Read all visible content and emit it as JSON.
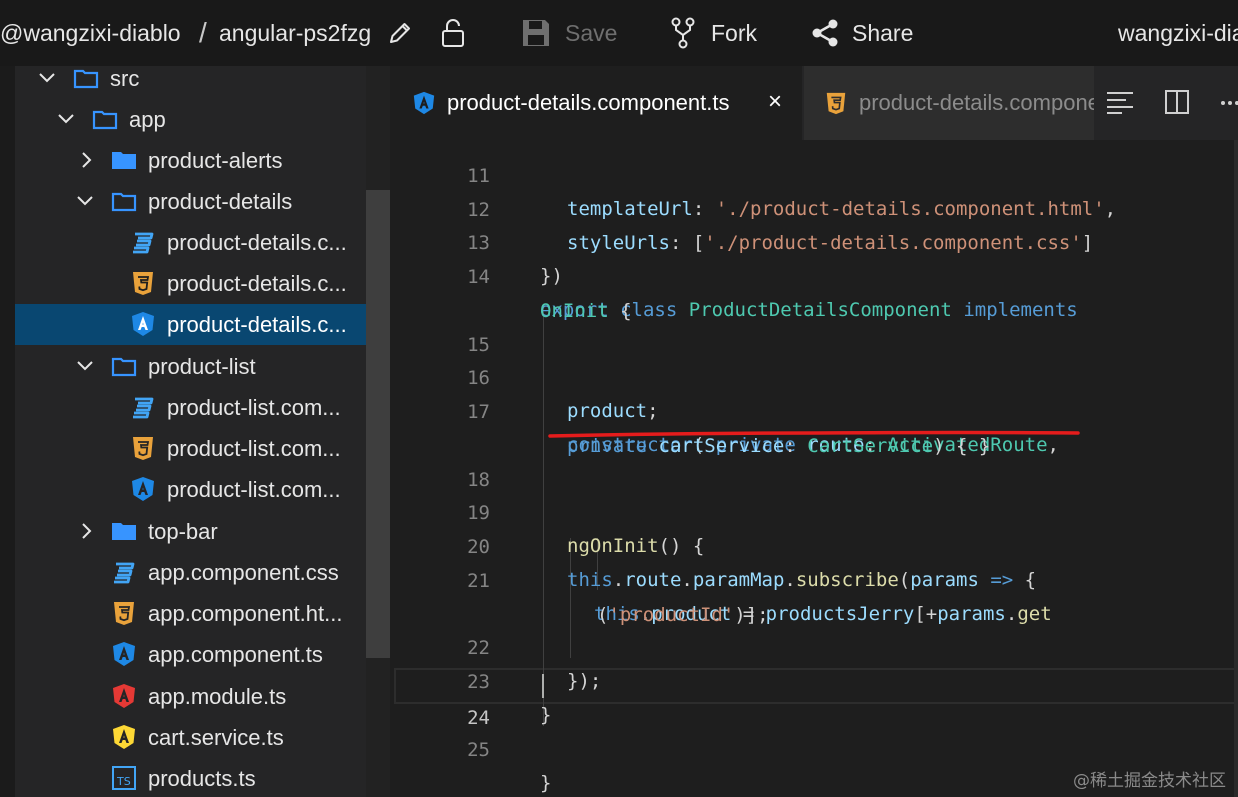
{
  "header": {
    "owner": "@wangzixi-diablo",
    "separator": "/",
    "project": "angular-ps2fzg",
    "save_label": "Save",
    "fork_label": "Fork",
    "share_label": "Share",
    "user": "wangzixi-diablo"
  },
  "sidebar": {
    "items": [
      {
        "label": "src",
        "type": "folder",
        "expanded": true
      },
      {
        "label": "app",
        "type": "folder",
        "expanded": true
      },
      {
        "label": "product-alerts",
        "type": "folder",
        "expanded": false
      },
      {
        "label": "product-details",
        "type": "folder",
        "expanded": true
      },
      {
        "label": "product-details.c...",
        "type": "css"
      },
      {
        "label": "product-details.c...",
        "type": "html"
      },
      {
        "label": "product-details.c...",
        "type": "angular",
        "selected": true
      },
      {
        "label": "product-list",
        "type": "folder",
        "expanded": true
      },
      {
        "label": "product-list.com...",
        "type": "css"
      },
      {
        "label": "product-list.com...",
        "type": "html"
      },
      {
        "label": "product-list.com...",
        "type": "angular"
      },
      {
        "label": "top-bar",
        "type": "folder",
        "expanded": false
      },
      {
        "label": "app.component.css",
        "type": "css"
      },
      {
        "label": "app.component.ht...",
        "type": "html"
      },
      {
        "label": "app.component.ts",
        "type": "angular"
      },
      {
        "label": "app.module.ts",
        "type": "angular-red"
      },
      {
        "label": "cart.service.ts",
        "type": "angular-yellow"
      },
      {
        "label": "products.ts",
        "type": "ts"
      }
    ]
  },
  "tabs": [
    {
      "label": "product-details.component.ts",
      "active": true,
      "close": "×",
      "icon": "angular-icon"
    },
    {
      "label": "product-details.component.html",
      "active": false,
      "icon": "html5-icon"
    }
  ],
  "editor": {
    "current_line": 24,
    "line_numbers": [
      "11",
      "12",
      "13",
      "14",
      "",
      "15",
      "16",
      "17",
      "",
      "18",
      "19",
      "20",
      "21",
      "",
      "22",
      "23",
      "24",
      "25"
    ],
    "lines": [
      "  templateUrl: './product-details.component.html',",
      "  styleUrls: ['./product-details.component.css']",
      "})",
      "export class ProductDetailsComponent implements",
      "OnInit {",
      "",
      "  product;",
      "  constructor( private route: ActivatedRoute,",
      "  private cartService: CartService) { }",
      "",
      "  ngOnInit() {",
      "  this.route.paramMap.subscribe(params => {",
      "    this.product = productsJerry[+params.get",
      "    ('productId')];",
      "  });",
      "}",
      "",
      "}"
    ]
  },
  "colors": {
    "keyword": "#569cd6",
    "class": "#4ec9b0",
    "string": "#ce9178",
    "variable": "#9cdcfe",
    "function": "#dcdcaa",
    "selection": "#094771",
    "annotation": "#e51c1c"
  },
  "watermark": "@稀土掘金技术社区"
}
